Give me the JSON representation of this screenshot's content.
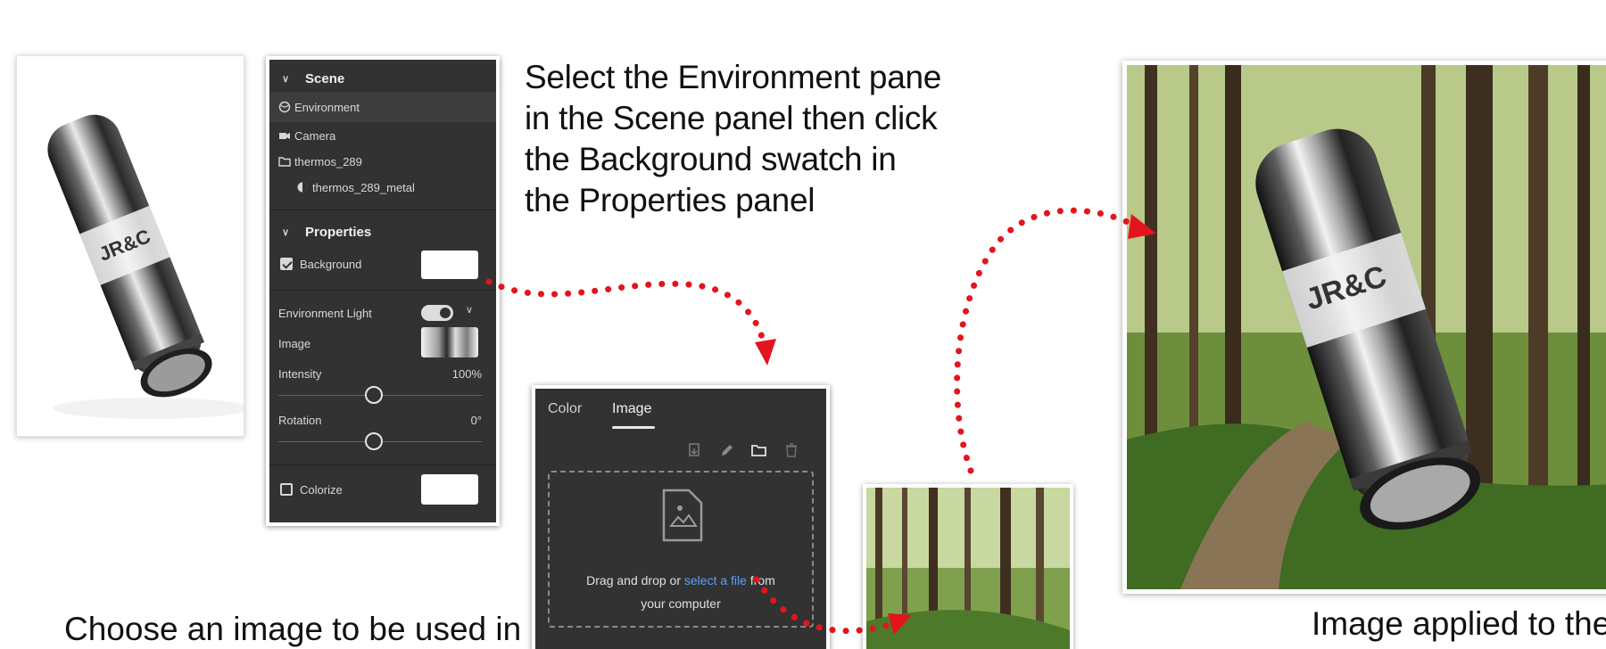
{
  "instructions": {
    "top": [
      "Select the Environment pane",
      "in the Scene panel then click",
      "the Background swatch in",
      "the Properties panel"
    ],
    "bottom_left": "Choose an image to be used in",
    "bottom_right": "Image  applied to the"
  },
  "scene_panel": {
    "scene_header": "Scene",
    "items": [
      {
        "label": "Environment",
        "icon": "environment-icon"
      },
      {
        "label": "Camera",
        "icon": "camera-icon"
      },
      {
        "label": "thermos_289",
        "icon": "folder-icon"
      },
      {
        "label": "thermos_289_metal",
        "icon": "material-icon"
      }
    ],
    "properties_header": "Properties",
    "background_label": "Background",
    "background_checked": true,
    "environment_light_label": "Environment Light",
    "environment_light_on": true,
    "image_label": "Image",
    "intensity_label": "Intensity",
    "intensity_value": "100%",
    "intensity_level": 0.47,
    "rotation_label": "Rotation",
    "rotation_value": "0°",
    "rotation_level": 0.47,
    "colorize_label": "Colorize",
    "colorize_checked": false
  },
  "image_dialog": {
    "tabs": [
      "Color",
      "Image"
    ],
    "active_tab": "Image",
    "toolbar_icons": [
      "import-icon",
      "edit-icon",
      "open-folder-icon",
      "delete-icon"
    ],
    "drop_text_before": "Drag and drop or ",
    "drop_link": "select a file",
    "drop_text_after": " from",
    "drop_text_line2": "your computer"
  },
  "colors": {
    "panel_bg": "#323232",
    "arrow": "#e3141d",
    "link": "#5aa0ff",
    "swatch": "#ffffff"
  }
}
